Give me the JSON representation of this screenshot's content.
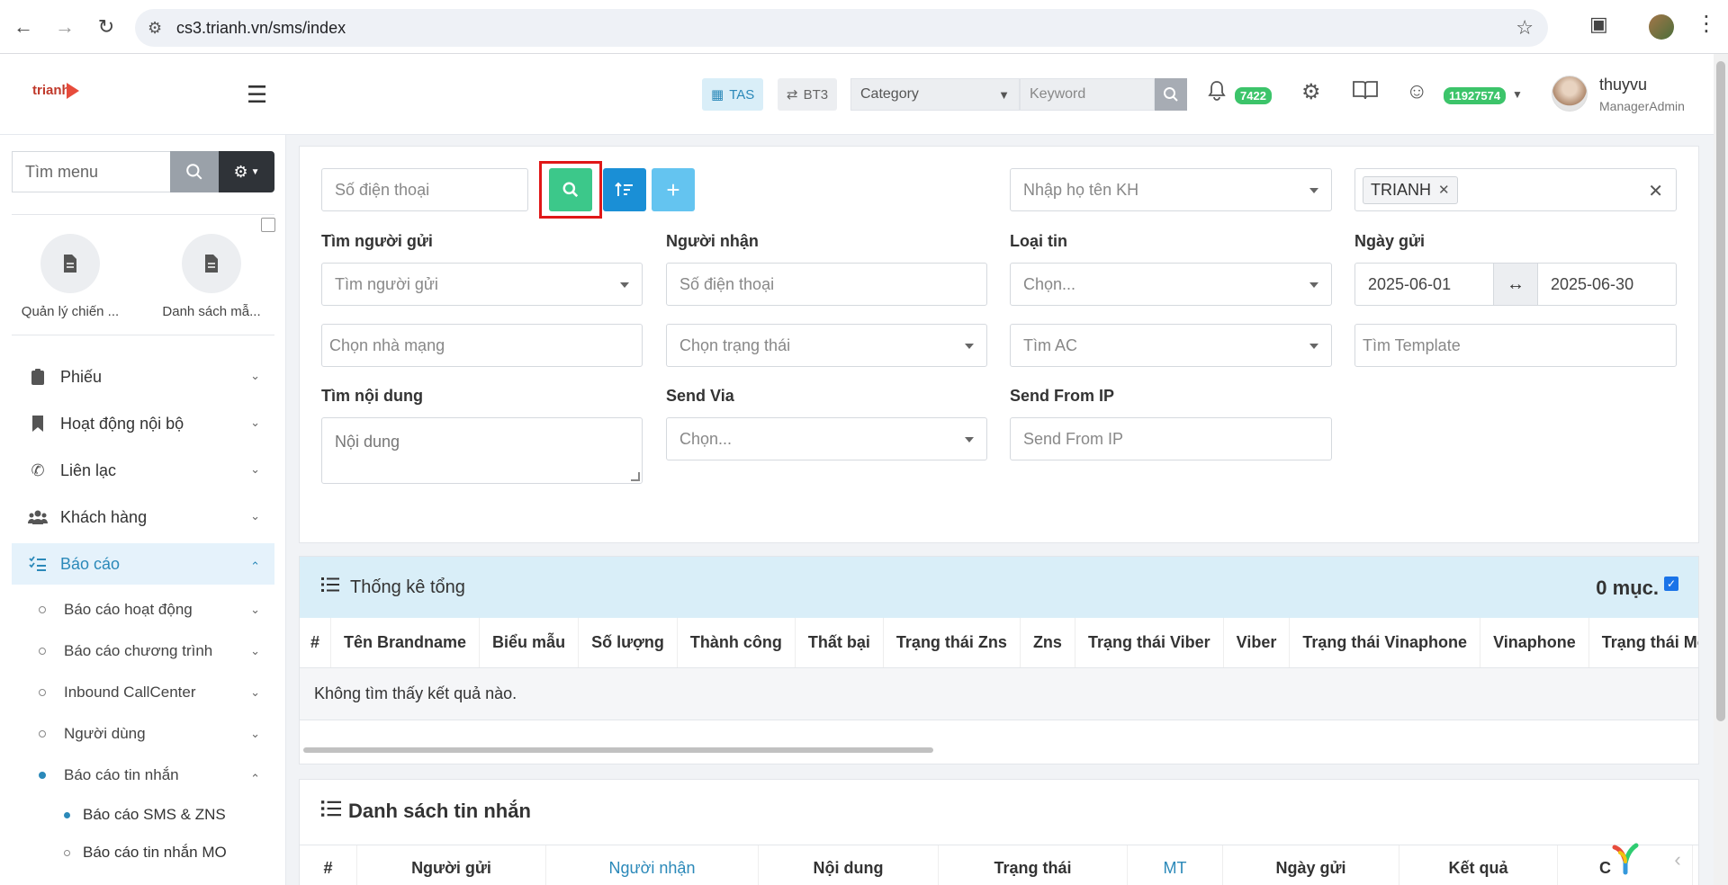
{
  "browser": {
    "url": "cs3.trianh.vn/sms/index"
  },
  "header": {
    "logo": "trianh",
    "tas_label": "TAS",
    "bt3_label": "BT3",
    "category_placeholder": "Category",
    "keyword_placeholder": "Keyword",
    "notification_count": "7422",
    "balance_badge": "11927574",
    "user_name": "thuyvu",
    "user_role": "ManagerAdmin"
  },
  "sidebar": {
    "search_placeholder": "Tìm menu",
    "quick_links": [
      {
        "label": "Quản lý chiến ..."
      },
      {
        "label": "Danh sách mẫ..."
      }
    ],
    "menu": [
      {
        "label": "Phiếu"
      },
      {
        "label": "Hoạt động nội bộ"
      },
      {
        "label": "Liên lạc"
      },
      {
        "label": "Khách hàng"
      },
      {
        "label": "Báo cáo"
      }
    ],
    "report_sub": [
      {
        "label": "Báo cáo hoạt động"
      },
      {
        "label": "Báo cáo chương trình"
      },
      {
        "label": "Inbound CallCenter"
      },
      {
        "label": "Người dùng"
      },
      {
        "label": "Báo cáo tin nhắn"
      }
    ],
    "message_sub": [
      {
        "label": "Báo cáo SMS & ZNS"
      },
      {
        "label": "Báo cáo tin nhắn MO"
      }
    ]
  },
  "filters": {
    "phone_placeholder": "Số điện thoại",
    "customer_placeholder": "Nhập họ tên KH",
    "brand_tag": "TRIANH",
    "sender_label": "Tìm người gửi",
    "sender_placeholder": "Tìm người gửi",
    "receiver_label": "Người nhận",
    "receiver_placeholder": "Số điện thoại",
    "type_label": "Loại tin",
    "type_placeholder": "Chọn...",
    "date_label": "Ngày gửi",
    "date_from": "2025-06-01",
    "date_to": "2025-06-30",
    "carrier_placeholder": "Chọn nhà mạng",
    "status_placeholder": "Chọn trạng thái",
    "ac_placeholder": "Tìm AC",
    "template_placeholder": "Tìm Template",
    "content_label": "Tìm nội dung",
    "content_placeholder": "Nội dung",
    "via_label": "Send Via",
    "via_placeholder": "Chọn...",
    "ip_label": "Send From IP",
    "ip_placeholder": "Send From IP"
  },
  "stats": {
    "title": "Thống kê tổng",
    "count": "0 mục.",
    "columns": [
      "#",
      "Tên Brandname",
      "Biểu mẫu",
      "Số lượng",
      "Thành công",
      "Thất bại",
      "Trạng thái Zns",
      "Zns",
      "Trạng thái Viber",
      "Viber",
      "Trạng thái Vinaphone",
      "Vinaphone",
      "Trạng thái Mobif"
    ],
    "empty_text": "Không tìm thấy kết quả nào."
  },
  "messages": {
    "title": "Danh sách tin nhắn",
    "columns": [
      "#",
      "Người gửi",
      "Người nhận",
      "Nội dung",
      "Trạng thái",
      "MT",
      "Ngày gửi",
      "Kết quả",
      "C"
    ]
  }
}
